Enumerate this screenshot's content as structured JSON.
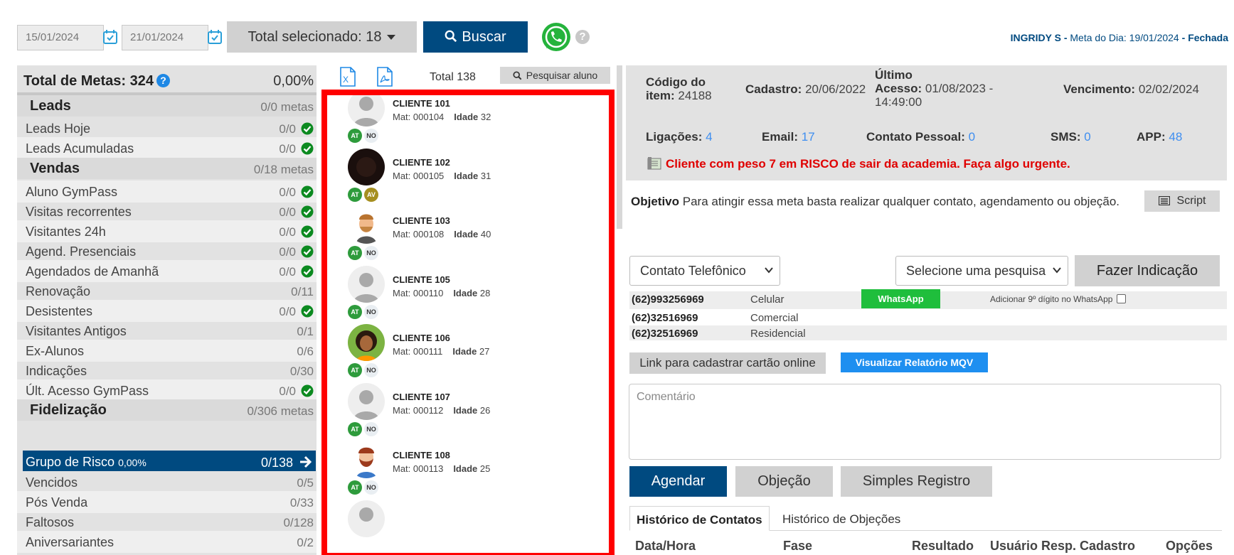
{
  "filters": {
    "date_start": "15/01/2024",
    "date_end": "21/01/2024",
    "total_selected": "Total selecionado: 18",
    "search_label": "Buscar"
  },
  "header_info": {
    "user": "INGRIDY S",
    "meta_label": "Meta do Dia: 19/01/2024",
    "status": "Fechada"
  },
  "left_panel": {
    "title": "Total de Metas: 324",
    "percent": "0,00%",
    "rows": [
      {
        "label": "Leads",
        "value": "0/0 metas",
        "type": "section"
      },
      {
        "label": "Leads Hoje",
        "value": "0/0",
        "check": true
      },
      {
        "label": "Leads Acumuladas",
        "value": "0/0",
        "check": true
      },
      {
        "label": "Vendas",
        "value": "0/18 metas",
        "type": "section"
      },
      {
        "label": "Aluno GymPass",
        "value": "0/0",
        "check": true
      },
      {
        "label": "Visitas recorrentes",
        "value": "0/0",
        "check": true
      },
      {
        "label": "Visitantes 24h",
        "value": "0/0",
        "check": true
      },
      {
        "label": "Agend. Presenciais",
        "value": "0/0",
        "check": true
      },
      {
        "label": "Agendados de Amanhã",
        "value": "0/0",
        "check": true
      },
      {
        "label": "Renovação",
        "value": "0/11",
        "check": false
      },
      {
        "label": "Desistentes",
        "value": "0/0",
        "check": true
      },
      {
        "label": "Visitantes Antigos",
        "value": "0/1",
        "check": false
      },
      {
        "label": "Ex-Alunos",
        "value": "0/6",
        "check": false
      },
      {
        "label": "Indicações",
        "value": "0/30",
        "check": false
      },
      {
        "label": "Últ. Acesso GymPass",
        "value": "0/0",
        "check": true
      },
      {
        "label": "Fidelização",
        "value": "0/306 metas",
        "type": "section"
      },
      {
        "label": "Grupo de Risco",
        "sub": "0,00%",
        "value": "0/138",
        "type": "active"
      },
      {
        "label": "Vencidos",
        "value": "0/5",
        "check": false
      },
      {
        "label": "Pós Venda",
        "value": "0/33",
        "check": false
      },
      {
        "label": "Faltosos",
        "value": "0/128",
        "check": false
      },
      {
        "label": "Aniversariantes",
        "value": "0/2",
        "check": false
      }
    ]
  },
  "middle_panel": {
    "total": "Total 138",
    "search_label": "Pesquisar aluno",
    "clients": [
      {
        "name": "CLIENTE 101",
        "mat": "Mat: 000104",
        "age_label": "Idade",
        "age": "32",
        "badges": [
          "AT",
          "NO"
        ],
        "avatar": "default-avatar"
      },
      {
        "name": "CLIENTE 102",
        "mat": "Mat: 000105",
        "age_label": "Idade",
        "age": "31",
        "badges": [
          "AT",
          "AV"
        ],
        "avatar": "photo-avatar"
      },
      {
        "name": "CLIENTE 103",
        "mat": "Mat: 000108",
        "age_label": "Idade",
        "age": "40",
        "badges": [
          "AT",
          "NO"
        ],
        "avatar": "cartoon-man-avatar"
      },
      {
        "name": "CLIENTE 105",
        "mat": "Mat: 000110",
        "age_label": "Idade",
        "age": "28",
        "badges": [
          "AT",
          "NO"
        ],
        "avatar": "default-avatar"
      },
      {
        "name": "CLIENTE 106",
        "mat": "Mat: 000111",
        "age_label": "Idade",
        "age": "27",
        "badges": [
          "AT",
          "NO"
        ],
        "avatar": "cartoon-woman-avatar"
      },
      {
        "name": "CLIENTE 107",
        "mat": "Mat: 000112",
        "age_label": "Idade",
        "age": "26",
        "badges": [
          "AT",
          "NO"
        ],
        "avatar": "default-avatar"
      },
      {
        "name": "CLIENTE 108",
        "mat": "Mat: 000113",
        "age_label": "Idade",
        "age": "25",
        "badges": [
          "AT",
          "NO"
        ],
        "avatar": "cartoon-bearded-avatar"
      }
    ]
  },
  "right_panel": {
    "codigo_label1": "Código do",
    "codigo_label2": "item:",
    "codigo_value": "24188",
    "cadastro_label": "Cadastro:",
    "cadastro_value": "20/06/2022",
    "ultimo_label1": "Último",
    "ultimo_label2": "Acesso:",
    "ultimo_value1": "01/08/2023 -",
    "ultimo_value2": "14:49:00",
    "vencimento_label": "Vencimento:",
    "vencimento_value": "02/02/2024",
    "ligacoes_label": "Ligações:",
    "ligacoes_value": "4",
    "email_label": "Email:",
    "email_value": "17",
    "contato_label": "Contato Pessoal:",
    "contato_value": "0",
    "sms_label": "SMS:",
    "sms_value": "0",
    "app_label": "APP:",
    "app_value": "48",
    "risk_message": "Cliente com peso 7 em RISCO de sair da academia. Faça algo urgente.",
    "objetivo_label": "Objetivo",
    "objetivo_text": "Para atingir essa meta basta realizar qualquer contato, agendamento ou objeção.",
    "script_label": "Script",
    "contact_type": "Contato Telefônico",
    "pesquisa_select": "Selecione uma pesquisa",
    "indicacao_label": "Fazer Indicação",
    "phones": [
      {
        "number": "(62)993256969",
        "type": "Celular"
      },
      {
        "number": "(62)32516969",
        "type": "Comercial"
      },
      {
        "number": "(62)32516969",
        "type": "Residencial"
      }
    ],
    "whatsapp_label": "WhatsApp",
    "digito_label": "Adicionar 9º dígito no WhatsApp",
    "link_label": "Link para cadastrar cartão online",
    "mqv_label": "Visualizar Relatório MQV",
    "comment_placeholder": "Comentário",
    "agendar_label": "Agendar",
    "objecao_label": "Objeção",
    "registro_label": "Simples Registro",
    "tab_contatos": "Histórico de Contatos",
    "tab_objecoes": "Histórico de Objeções",
    "headers": [
      "Data/Hora",
      "Fase",
      "Resultado",
      "Usuário Resp. Cadastro",
      "Opções"
    ]
  },
  "colors": {
    "primary": "#004a80",
    "accent_blue": "#1e8ff0",
    "success": "#1fbe3c",
    "danger": "#e00000",
    "highlight_border": "#ff0000"
  }
}
